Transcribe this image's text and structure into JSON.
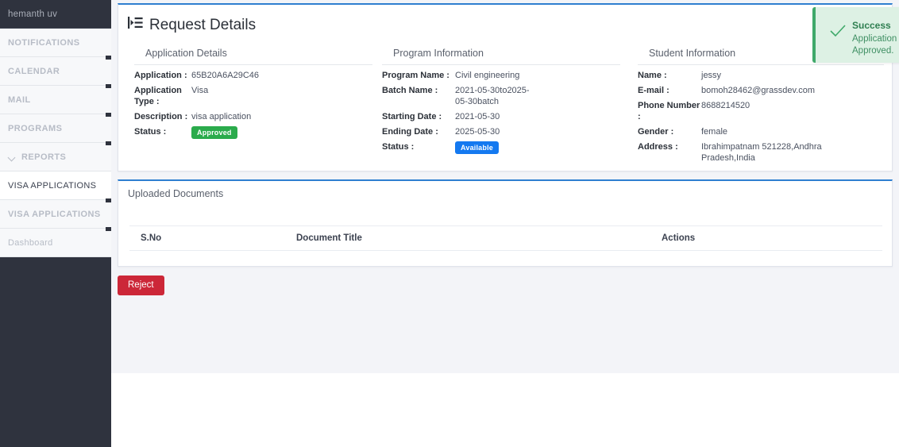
{
  "sidebar": {
    "user": "hemanth uv",
    "items": [
      {
        "label": "NOTIFICATIONS",
        "caret": false,
        "active": false,
        "notch": false
      },
      {
        "label": "CALENDAR",
        "caret": false,
        "active": false,
        "notch": true
      },
      {
        "label": "MAIL",
        "caret": false,
        "active": false,
        "notch": true
      },
      {
        "label": "PROGRAMS",
        "caret": false,
        "active": false,
        "notch": true
      },
      {
        "label": "REPORTS",
        "caret": true,
        "active": false,
        "notch": true
      },
      {
        "label": "VISA APPLICATIONS",
        "caret": false,
        "active": true,
        "notch": false
      },
      {
        "label": "VISA APPLICATIONS",
        "caret": false,
        "active": false,
        "notch": true
      },
      {
        "label": "Dashboard",
        "caret": false,
        "active": false,
        "notch": true,
        "plain": true
      }
    ]
  },
  "page": {
    "title": "Request Details",
    "title_icon": "list-details-icon"
  },
  "application_details": {
    "heading": "Application Details",
    "rows": [
      {
        "key": "Application :",
        "value": "65B20A6A29C46"
      },
      {
        "key": "Application Type :",
        "value": "Visa"
      },
      {
        "key": "Description :",
        "value": "visa application"
      }
    ],
    "status_key": "Status :",
    "status_value": "Approved",
    "status_color": "#2bab4c"
  },
  "program_information": {
    "heading": "Program Information",
    "rows": [
      {
        "key": "Program Name :",
        "value": "Civil engineering"
      },
      {
        "key": "Batch Name :",
        "value": "2021-05-30to2025-05-30batch"
      },
      {
        "key": "Starting Date :",
        "value": "2021-05-30"
      },
      {
        "key": "Ending Date :",
        "value": "2025-05-30"
      }
    ],
    "status_key": "Status :",
    "status_value": "Available",
    "status_color": "#1479f0"
  },
  "student_information": {
    "heading": "Student Information",
    "rows": [
      {
        "key": "Name :",
        "value": "jessy"
      },
      {
        "key": "E-mail :",
        "value": "bomoh28462@grassdev.com"
      },
      {
        "key": "Phone Number :",
        "value": "8688214520"
      },
      {
        "key": "Gender :",
        "value": "female"
      },
      {
        "key": "Address :",
        "value": "Ibrahimpatnam 521228,Andhra Pradesh,India"
      }
    ]
  },
  "uploaded_documents": {
    "heading": "Uploaded Documents",
    "columns": [
      "S.No",
      "Document Title",
      "Actions"
    ],
    "rows": []
  },
  "actions": {
    "reject_label": "Reject",
    "reject_color": "#cc2738"
  },
  "toast": {
    "title": "Success",
    "message": "Application was successfully Approved.",
    "icon": "check-icon",
    "close_icon": "close-icon",
    "accent_color": "#3fa96a",
    "background_color": "#ddf1e4"
  }
}
